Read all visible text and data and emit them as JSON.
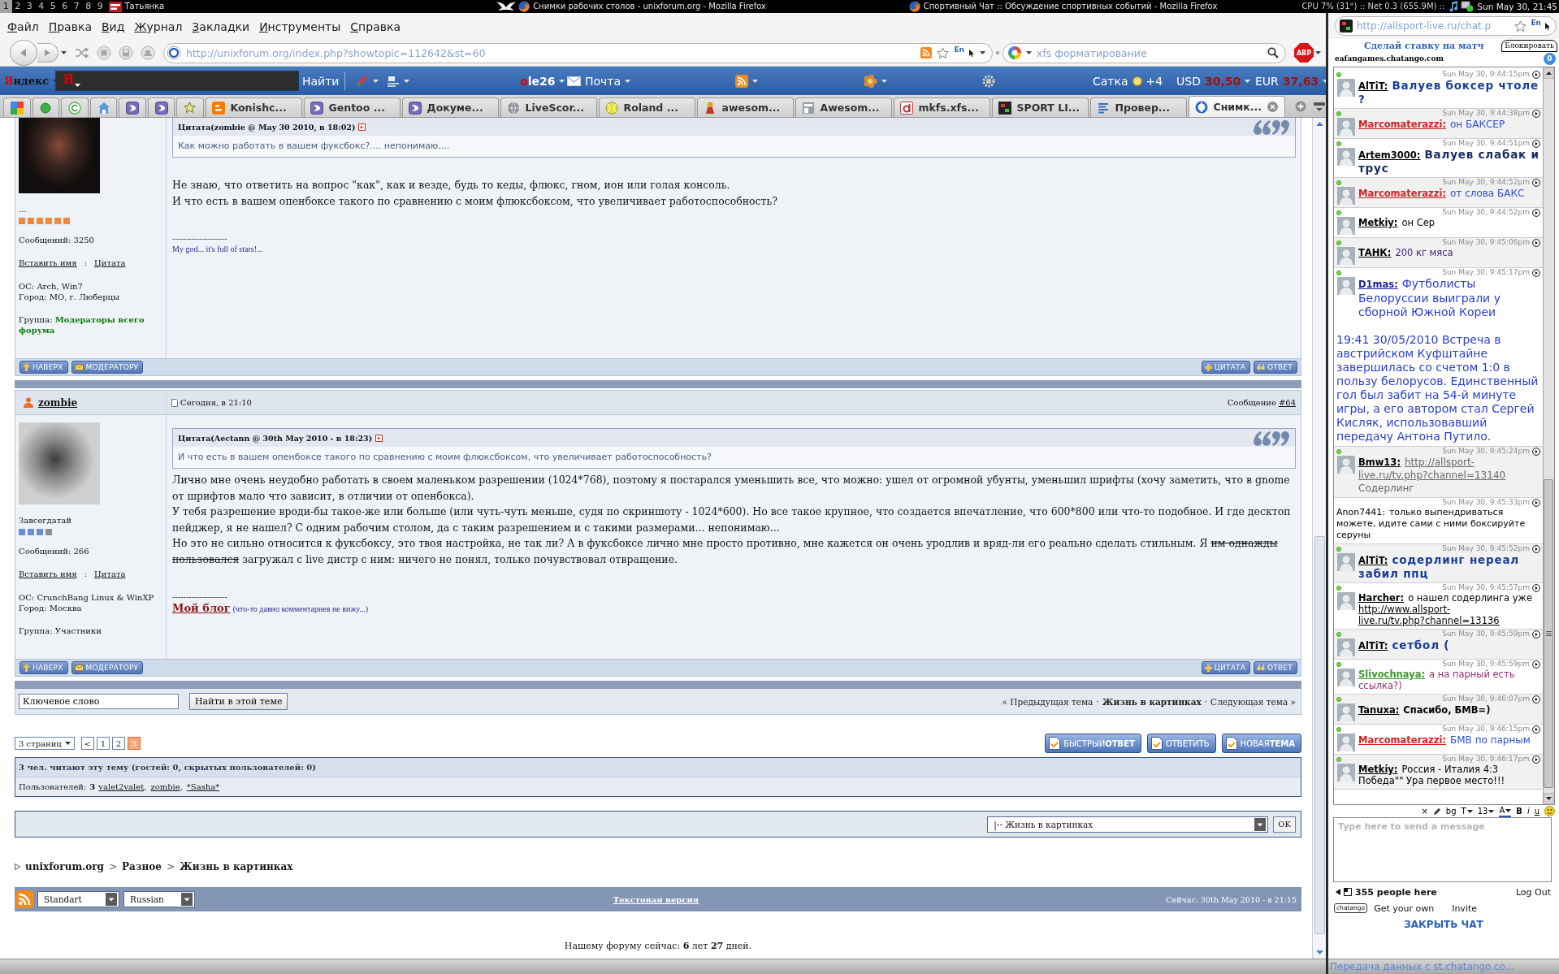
{
  "panel": {
    "workspaces": [
      {
        "label": "1",
        "selected": true
      },
      {
        "label": "2",
        "selected": false
      },
      {
        "label": "3",
        "selected": false
      },
      {
        "label": "4",
        "selected": false
      },
      {
        "label": "5",
        "selected": false
      },
      {
        "label": "6",
        "selected": false
      },
      {
        "label": "7",
        "selected": false
      },
      {
        "label": "8",
        "selected": false
      },
      {
        "label": "9",
        "selected": false
      }
    ],
    "tasks": [
      {
        "title": "Татьянка",
        "kind": "app"
      },
      {
        "title": "Снимки рабочих столов - unixforum.org - Mozilla Firefox",
        "kind": "browser"
      },
      {
        "title": "Спортивный Чат :: Обсуждение спортивных событий - Mozilla Firefox",
        "kind": "browser"
      }
    ],
    "monitor": "CPU 7% (31°) :: Net 0.3 (655.9M) ::",
    "clock": "Sun May 30, 21:45"
  },
  "menu": [
    "Файл",
    "Правка",
    "Вид",
    "Журнал",
    "Закладки",
    "Инструменты",
    "Справка"
  ],
  "navigation": {
    "url": "http://unixforum.org/index.php?showtopic=112642&st=60",
    "language": "En",
    "search": "xfs форматирование",
    "adblock": "ABP"
  },
  "yandex_bar": {
    "logo": "Яндекс",
    "search_logo": "Я",
    "find": "Найти",
    "user": "ole26",
    "mail": "Почта",
    "location": "Сатка",
    "temperature": "+4",
    "usd_label": "USD",
    "usd": "30,50",
    "eur_label": "EUR",
    "eur": "37,63"
  },
  "tabs": [
    {
      "kind": "google",
      "selected": false
    },
    {
      "kind": "dot",
      "selected": false
    },
    {
      "kind": "refresh",
      "selected": false
    },
    {
      "kind": "home",
      "selected": false
    },
    {
      "kind": "gentoo",
      "selected": false
    },
    {
      "kind": "gentoo",
      "selected": false
    },
    {
      "kind": "star",
      "selected": false
    },
    {
      "kind": "blogger",
      "label": "Konishc...",
      "selected": false
    },
    {
      "kind": "gentoo",
      "label": "Gentoo ...",
      "selected": false
    },
    {
      "kind": "gentoo",
      "label": "Докуме...",
      "selected": false
    },
    {
      "kind": "globe",
      "label": "LiveScor...",
      "selected": false
    },
    {
      "kind": "ball",
      "label": "Roland ...",
      "selected": false
    },
    {
      "kind": "figure",
      "label": "awesom...",
      "selected": false
    },
    {
      "kind": "page",
      "label": "Awesom...",
      "selected": false
    },
    {
      "kind": "mkfs",
      "label": "mkfs.xfs...",
      "selected": false
    },
    {
      "kind": "sport",
      "label": "SPORT LI...",
      "selected": false
    },
    {
      "kind": "lines",
      "label": "Провер...",
      "selected": false
    },
    {
      "kind": "forum",
      "label": "Снимк...",
      "selected": true
    }
  ],
  "forum": {
    "posts": [
      {
        "avatar": {
          "kind": "dark"
        },
        "rank": {
          "title": "...",
          "color": "#f0883e",
          "pips": [
            {
              "filled": true
            },
            {
              "filled": true
            },
            {
              "filled": true
            },
            {
              "filled": true
            },
            {
              "filled": true
            },
            {
              "filled": true
            }
          ]
        },
        "posts_count": "Сообщений: 3250",
        "insert_name": "Вставить имя",
        "link_separator": ":",
        "quote_link": "Цитата",
        "os": "ОС: Arch, Win7",
        "city": "Город: МО, г. Люберцы",
        "group": {
          "label": "Группа:",
          "value": "Модераторы всего форума",
          "kind": "moderator"
        },
        "quote": {
          "header": "Цитата(zombie @ May 30 2010, в 18:02)",
          "text": "Как можно работать в вашем фуксбокс?.... непонимаю...."
        },
        "paragraphs": [
          {
            "segments": [
              {
                "text": "Не знаю, что ответить на вопрос \"как\", как и везде, будь то кеды, флюкс, гном, ион или голая консоль.",
                "struck": false
              }
            ]
          },
          {
            "segments": [
              {
                "text": "И что есть в вашем опенбоксе такого по сравнению с моим флюксбоксом, что увеличивает работоспособность?",
                "struck": false
              }
            ]
          }
        ],
        "signature_rule": "--------------------",
        "signature": [
          {
            "kind": "note",
            "text": "My god... it's full of stars!..."
          }
        ],
        "buttons": [
          {
            "label": "НАВЕРХ",
            "kind": "top"
          },
          {
            "label": "МОДЕРАТОРУ",
            "kind": "report"
          },
          {
            "label": "ЦИТАТА",
            "kind": "quote"
          },
          {
            "label": "ОТВЕТ",
            "kind": "reply"
          }
        ]
      },
      {
        "header": {
          "author": "zombie",
          "date": "Сегодня, в 21:10",
          "number_label": "Сообщение",
          "number": "#64"
        },
        "avatar": {
          "kind": "light"
        },
        "rank": {
          "title": "Завсегдатай",
          "color": "#6a8ed6",
          "pips": [
            {
              "filled": true
            },
            {
              "filled": true
            },
            {
              "filled": true
            },
            {
              "filled": false
            }
          ]
        },
        "posts_count": "Сообщений: 266",
        "insert_name": "Вставить имя",
        "link_separator": ":",
        "quote_link": "Цитата",
        "os": "ОС: CrunchBang Linux & WinXP",
        "city": "Город: Москва",
        "group": {
          "label": "Группа:",
          "value": "Участники",
          "kind": "member"
        },
        "quote": {
          "header": "Цитата(Aectann @ 30th May 2010 - в 18:23)",
          "text": "И что есть в вашем опенбоксе такого по сравнению с моим флюксбоксом, что увеличивает работоспособность?"
        },
        "paragraphs": [
          {
            "segments": [
              {
                "text": "Лично мне очень неудобно работать в своем маленьком разрешении (1024*768), поэтому я постарался уменьшить все, что можно: ушел от огромной убунты, уменьшил шрифты (хочу заметить, что в gnome от шрифтов мало что зависит, в отличии от опенбокса).",
                "struck": false
              }
            ]
          },
          {
            "segments": [
              {
                "text": "У тебя разрешение вроди-бы такое-же или больше (или чуть-чуть меньше, судя по скриншоту - 1024*600). Но все такое крупное, что создается впечатление, что 600*800 или что-то подобное. И где десктоп пейджер, я не нашел? С одним рабочим столом, да с таким разрешением и с такими размерами... непонимаю...",
                "struck": false
              }
            ]
          },
          {
            "segments": [
              {
                "text": "Но это не сильно относится к фуксбоксу, это твоя настройка, не так ли? А в фуксбоксе лично мне просто противно, мне кажется он очень уродлив и вряд-ли его реально сделать стильным. Я ",
                "struck": false
              },
              {
                "text": "им однажды пользовался",
                "struck": true
              },
              {
                "text": " загружал с live дистр с ним: ничего не понял, только почувствовал отвращение.",
                "struck": false
              }
            ]
          }
        ],
        "signature_rule": "--------------------",
        "signature": [
          {
            "kind": "link",
            "text": "Мой блог"
          },
          {
            "kind": "note",
            "text": "(что-то давно комментариев не вижу...)"
          }
        ],
        "buttons": [
          {
            "label": "НАВЕРХ",
            "kind": "top"
          },
          {
            "label": "МОДЕРАТОРУ",
            "kind": "report"
          },
          {
            "label": "ЦИТАТА",
            "kind": "quote"
          },
          {
            "label": "ОТВЕТ",
            "kind": "reply"
          }
        ]
      }
    ],
    "topic_search": {
      "value": "Ключевое слово",
      "button": "Найти в этой теме"
    },
    "topic_nav": {
      "previous": "« Предыдущая тема",
      "separator": "·",
      "current": "Жизнь в картинках",
      "next": "Следующая тема »"
    },
    "pages": {
      "menu": "3 страниц",
      "items": [
        {
          "label": "<",
          "selected": false
        },
        {
          "label": "1",
          "selected": false
        },
        {
          "label": "2",
          "selected": false
        },
        {
          "label": "3",
          "selected": true
        }
      ]
    },
    "actions": [
      {
        "label": "БЫСТРЫЙ**ОТВЕТ**"
      },
      {
        "label": "ОТВЕТИТЬ"
      },
      {
        "label": "НОВАЯ**ТЕМА**"
      }
    ],
    "online": {
      "title": "3 чел. читают эту тему (гостей: 0, скрытых пользователей: 0)",
      "label": "Пользователей:",
      "count": "3",
      "users": [
        "valet2valet",
        "zombie",
        "*Sasha*"
      ],
      "separator": ","
    },
    "jump": {
      "value": "|-- Жизнь в картинках",
      "button": "OK"
    },
    "breadcrumb": {
      "items": [
        "unixforum.org",
        "Разное",
        "Жизнь в картинках"
      ],
      "separator": ">"
    },
    "footer": {
      "skin": "Standart",
      "language": "Russian",
      "text_version": "Текстовая версия",
      "now": "Сейчас: 30th May 2010 - в 21:15"
    },
    "forum_age": "Нашему форуму сейчас: **6** лет **27** дней."
  },
  "chat": {
    "url": "http://allsport-live.ru/chat.p",
    "language": "En",
    "promo": "Сделай ставку на матч",
    "tooltip": "Блокировать",
    "host": "eafangames.chatango.com",
    "unread": "0",
    "messages": [
      {
        "time": "Sun May 30, 9:44:15pm",
        "online": true,
        "name": {
          "text": "AlTiT:",
          "color": "#000000"
        },
        "color": "#1b3d99",
        "kind": "shout",
        "body": [
          {
            "kind": "text",
            "text": "Валуев боксер чтоле ?"
          }
        ]
      },
      {
        "time": "Sun May 30, 9:44:38pm",
        "online": true,
        "name": {
          "text": "Marcomaterazzi:",
          "color": "#d42020"
        },
        "color": "#2c50d6",
        "kind": "normal",
        "body": [
          {
            "kind": "text",
            "text": "он БАКСЕР"
          }
        ]
      },
      {
        "time": "Sun May 30, 9:44:51pm",
        "online": true,
        "name": {
          "text": "Artem3000:",
          "color": "#000000"
        },
        "color": "#1b2a66",
        "kind": "shout",
        "body": [
          {
            "kind": "text",
            "text": "Валуев слабак и трус"
          }
        ]
      },
      {
        "time": "Sun May 30, 9:44:52pm",
        "online": true,
        "name": {
          "text": "Marcomaterazzi:",
          "color": "#d42020"
        },
        "color": "#2c50d6",
        "kind": "normal",
        "body": [
          {
            "kind": "text",
            "text": "от слова БАКС"
          }
        ]
      },
      {
        "time": "Sun May 30, 9:44:52pm",
        "online": true,
        "name": {
          "text": "Metkiy:",
          "color": "#000000"
        },
        "color": "#000000",
        "kind": "small",
        "body": [
          {
            "kind": "text",
            "text": "он Сер"
          }
        ]
      },
      {
        "time": "Sun May 30, 9:45:06pm",
        "online": true,
        "name": {
          "text": "ТАНК:",
          "color": "#000000"
        },
        "color": "#3d1f78",
        "kind": "small",
        "body": [
          {
            "kind": "text",
            "text": "200 кг мяса"
          }
        ]
      },
      {
        "time": "Sun May 30, 9:45:17pm",
        "online": true,
        "name": {
          "text": "D1mas:",
          "color": "#1c1ca8"
        },
        "color": "#2b40d0",
        "kind": "large",
        "body": [
          {
            "kind": "text",
            "text": "Футболисты Белоруссии выиграли у сборной Южной Кореи"
          },
          {
            "kind": "paragraph",
            "text": "19:41 30/05/2010 Встреча в австрийском Куфштайне завершилась со счетом 1:0 в пользу белорусов. Единственный гол был забит на 54-й минуте игры, а его автором стал Сергей Кисляк, использовавший передачу Антона Путило."
          }
        ]
      },
      {
        "time": "Sun May 30, 9:45:24pm",
        "online": true,
        "name": {
          "text": "Bmw13:",
          "color": "#000000"
        },
        "color": "#6a6a6a",
        "kind": "normal",
        "body": [
          {
            "kind": "link",
            "text": "http://allsport-"
          },
          {
            "kind": "link-line",
            "text": "live.ru/tv.php?channel=13140"
          },
          {
            "kind": "line",
            "text": "Содерлинг"
          }
        ]
      },
      {
        "time": "Sun May 30, 9:45:33pm",
        "online": false,
        "name": {
          "text": "Anon7441:",
          "color": "#000000"
        },
        "color": "#000000",
        "kind": "anonymous",
        "body": [
          {
            "kind": "text",
            "text": "только выпендриваться можете, идите сами с ними боксируйте серуны"
          }
        ]
      },
      {
        "time": "Sun May 30, 9:45:52pm",
        "online": true,
        "name": {
          "text": "AlTiT:",
          "color": "#000000"
        },
        "color": "#1b3d99",
        "kind": "shout",
        "body": [
          {
            "kind": "text",
            "text": "содерлинг нереал забил ппц"
          }
        ]
      },
      {
        "time": "Sun May 30, 9:45:57pm",
        "online": true,
        "name": {
          "text": "Harcher:",
          "color": "#000000"
        },
        "color": "#000000",
        "kind": "small",
        "body": [
          {
            "kind": "text",
            "text": "о нашел содерлинга уже"
          },
          {
            "kind": "link-line",
            "text": "http://www.allsport-"
          },
          {
            "kind": "link-line",
            "text": "live.ru/tv.php?channel=13136"
          }
        ]
      },
      {
        "time": "Sun May 30, 9:45:59pm",
        "online": true,
        "name": {
          "text": "AlTiT:",
          "color": "#000000"
        },
        "color": "#1b3d99",
        "kind": "shout",
        "body": [
          {
            "kind": "text",
            "text": "сетбол ("
          }
        ]
      },
      {
        "time": "Sun May 30, 9:45:59pm",
        "online": true,
        "name": {
          "text": "Slivochnaya:",
          "color": "#3a9a2a"
        },
        "color": "#9b2f6f",
        "kind": "small",
        "body": [
          {
            "kind": "text",
            "text": "а на парный есть ссылка?)"
          }
        ]
      },
      {
        "time": "Sun May 30, 9:46:07pm",
        "online": true,
        "name": {
          "text": "Tanuxa:",
          "color": "#000000"
        },
        "color": "#000000",
        "kind": "bold",
        "body": [
          {
            "kind": "text",
            "text": "Спасибо, БМВ=)"
          }
        ]
      },
      {
        "time": "Sun May 30, 9:46:15pm",
        "online": true,
        "name": {
          "text": "Marcomaterazzi:",
          "color": "#d42020"
        },
        "color": "#2c50d6",
        "kind": "normal",
        "body": [
          {
            "kind": "text",
            "text": "БМВ по парным"
          }
        ]
      },
      {
        "time": "Sun May 30, 9:46:17pm",
        "online": true,
        "name": {
          "text": "Metkiy:",
          "color": "#000000"
        },
        "color": "#000000",
        "kind": "small",
        "body": [
          {
            "kind": "text",
            "text": "Россия - Италия 4:3 Победа\"\" Ура первое место!!!"
          }
        ]
      }
    ],
    "tools": [
      {
        "kind": "clear",
        "label": "×"
      },
      {
        "kind": "pencil"
      },
      {
        "kind": "background",
        "label": "bg"
      },
      {
        "kind": "font",
        "label": "T"
      },
      {
        "kind": "size",
        "label": "13"
      },
      {
        "kind": "color",
        "label": "A"
      },
      {
        "kind": "bold",
        "label": "B"
      },
      {
        "kind": "italic",
        "label": "i"
      },
      {
        "kind": "underline",
        "label": "u"
      },
      {
        "kind": "smiley"
      }
    ],
    "placeholder": "Type here to send a message",
    "people": "355 people here",
    "logout": "Log Out",
    "logo": "chatango",
    "get_own": "Get your own",
    "invite": "Invite",
    "close": "ЗАКРЫТЬ ЧАТ",
    "status": "Передача данных с st.chatango.co..."
  }
}
